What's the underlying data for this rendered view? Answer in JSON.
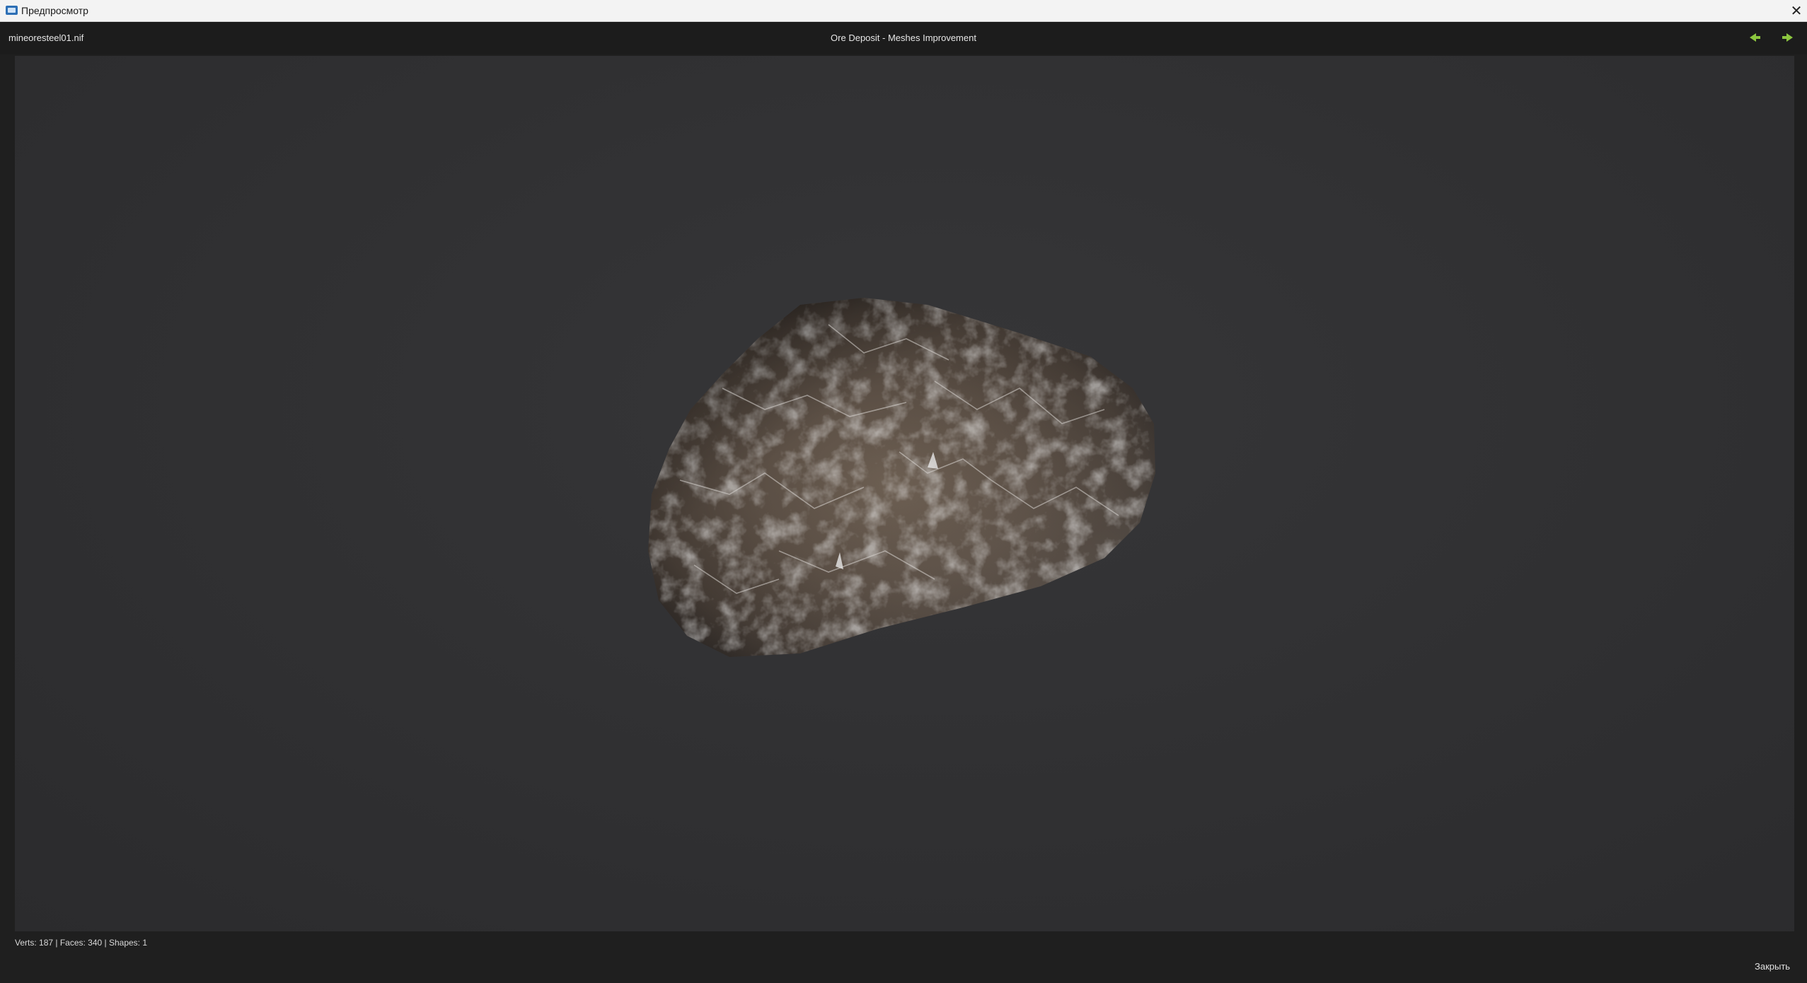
{
  "window": {
    "title": "Предпросмотр",
    "close_symbol": "✕"
  },
  "header": {
    "file_name": "mineoresteel01.nif",
    "mod_title": "Ore Deposit - Meshes Improvement",
    "prev_icon": "arrow-left-icon",
    "next_icon": "arrow-right-icon",
    "accent_color": "#8cc63f"
  },
  "viewport": {
    "background": "#303032",
    "object": "ore-rock-mesh"
  },
  "footer": {
    "stats": "Verts: 187 | Faces: 340 | Shapes: 1",
    "close_label": "Закрыть"
  }
}
